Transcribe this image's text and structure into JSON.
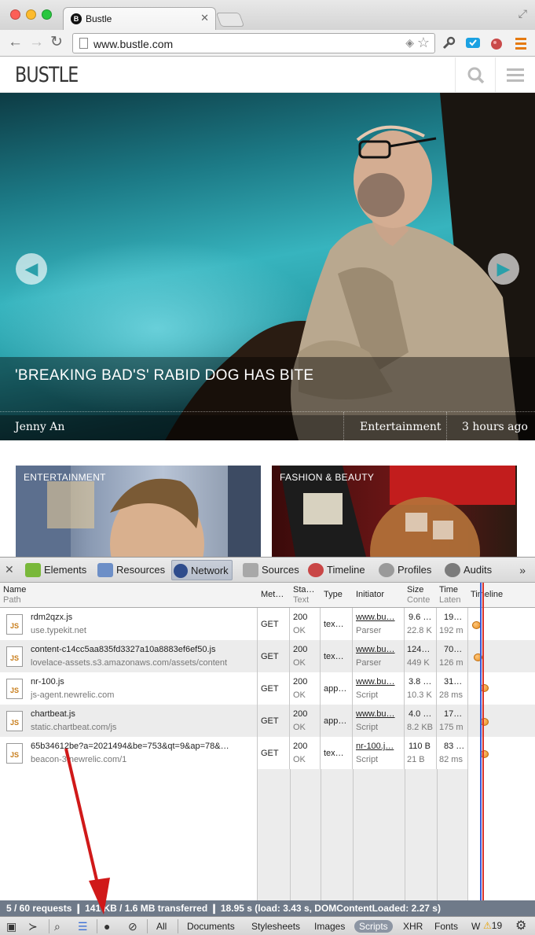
{
  "browser": {
    "tab_title": "Bustle",
    "tab_favicon": "B",
    "url": "www.bustle.com"
  },
  "site": {
    "logo": "BUSTLE",
    "hero": {
      "headline": "'BREAKING BAD'S' RABID DOG HAS BITE",
      "author": "Jenny An",
      "category": "Entertainment",
      "time": "3 hours ago"
    },
    "cards": [
      {
        "label": "ENTERTAINMENT"
      },
      {
        "label": "FASHION & BEAUTY"
      }
    ]
  },
  "devtools": {
    "tabs": [
      "Elements",
      "Resources",
      "Network",
      "Sources",
      "Timeline",
      "Profiles",
      "Audits"
    ],
    "active_tab": "Network",
    "more": "»",
    "columns": [
      {
        "top": "Name",
        "sub": "Path"
      },
      {
        "top": "Met…",
        "sub": ""
      },
      {
        "top": "Sta…",
        "sub": "Text"
      },
      {
        "top": "Type",
        "sub": ""
      },
      {
        "top": "Initiator",
        "sub": ""
      },
      {
        "top": "Size",
        "sub": "Conte"
      },
      {
        "top": "Time",
        "sub": "Laten"
      },
      {
        "top": "Timeline",
        "sub": ""
      }
    ],
    "rows": [
      {
        "name": "rdm2qzx.js",
        "path": "use.typekit.net",
        "method": "GET",
        "status": "200",
        "status_text": "OK",
        "type": "tex…",
        "initiator": "www.bu…",
        "init_sub": "Parser",
        "size": "9.6 …",
        "size_sub": "22.8 K",
        "time": "19…",
        "time_sub": "192 m"
      },
      {
        "name": "content-c14cc5aa835fd3327a10a8883ef6ef50.js",
        "path": "lovelace-assets.s3.amazonaws.com/assets/content",
        "method": "GET",
        "status": "200",
        "status_text": "OK",
        "type": "tex…",
        "initiator": "www.bu…",
        "init_sub": "Parser",
        "size": "124…",
        "size_sub": "449 K",
        "time": "70…",
        "time_sub": "126 m"
      },
      {
        "name": "nr-100.js",
        "path": "js-agent.newrelic.com",
        "method": "GET",
        "status": "200",
        "status_text": "OK",
        "type": "app…",
        "initiator": "www.bu…",
        "init_sub": "Script",
        "size": "3.8 …",
        "size_sub": "10.3 K",
        "time": "31…",
        "time_sub": "28 ms"
      },
      {
        "name": "chartbeat.js",
        "path": "static.chartbeat.com/js",
        "method": "GET",
        "status": "200",
        "status_text": "OK",
        "type": "app…",
        "initiator": "www.bu…",
        "init_sub": "Script",
        "size": "4.0 …",
        "size_sub": "8.2 KB",
        "time": "17…",
        "time_sub": "175 m"
      },
      {
        "name": "65b34612be?a=2021494&be=753&qt=9&ap=78&…",
        "path": "beacon-3.newrelic.com/1",
        "method": "GET",
        "status": "200",
        "status_text": "OK",
        "type": "tex…",
        "initiator": "nr-100.j…",
        "init_sub": "Script",
        "size": "110 B",
        "size_sub": "21 B",
        "time": "83 …",
        "time_sub": "82 ms"
      }
    ],
    "summary": "5 / 60 requests  ❙  141 KB / 1.6 MB transferred  ❙  18.95 s (load: 3.43 s, DOMContentLoaded: 2.27 s)",
    "filters": [
      "All",
      "Documents",
      "Stylesheets",
      "Images",
      "Scripts",
      "XHR",
      "Fonts",
      "W"
    ],
    "active_filter": "Scripts",
    "warning_count": "19"
  },
  "colors": {
    "accent_blue": "#3b5bd6",
    "accent_red": "#d9342b",
    "status_bar": "#6f7a89"
  }
}
